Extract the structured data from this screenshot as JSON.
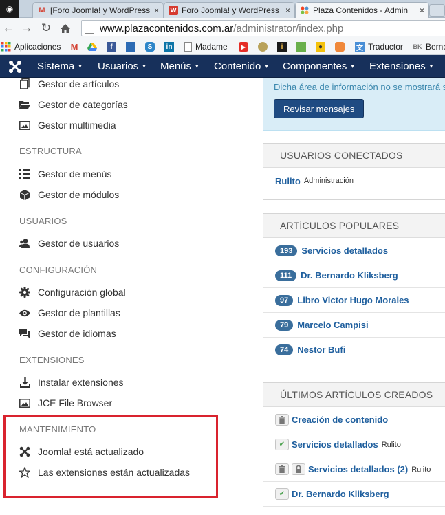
{
  "browser": {
    "tabs": [
      {
        "title": "[Foro Joomla! y WordPress"
      },
      {
        "title": "Foro Joomla! y WordPress"
      },
      {
        "title": "Plaza Contenidos - Admin"
      }
    ],
    "close_glyph": "×",
    "url_host": "www.plazacontenidos.com.ar",
    "url_path": "/administrator/index.php",
    "bookmarks": [
      {
        "label": "Aplicaciones",
        "icon": "apps-grid-icon"
      },
      {
        "label": "",
        "icon": "gmail-icon"
      },
      {
        "label": "",
        "icon": "drive-icon"
      },
      {
        "label": "",
        "icon": "facebook-icon"
      },
      {
        "label": "",
        "icon": "blue-square-icon"
      },
      {
        "label": "",
        "icon": "skype-icon"
      },
      {
        "label": "",
        "icon": "linkedin-icon"
      },
      {
        "label": "Madame",
        "icon": "page-icon"
      },
      {
        "label": "",
        "icon": "youtube-icon"
      },
      {
        "label": "",
        "icon": "eye-bookmark-icon"
      },
      {
        "label": "",
        "icon": "info-icon"
      },
      {
        "label": "",
        "icon": "puzzle-icon"
      },
      {
        "label": "",
        "icon": "map-pin-icon"
      },
      {
        "label": "",
        "icon": "orange-app-icon"
      },
      {
        "label": "Traductor",
        "icon": "translate-icon"
      },
      {
        "label": "Berne",
        "icon": "bk-icon"
      }
    ]
  },
  "joomla_nav": {
    "items": [
      "Sistema",
      "Usuarios",
      "Menús",
      "Contenido",
      "Componentes",
      "Extensiones"
    ],
    "caret": "▾"
  },
  "sidebar": {
    "content_items": [
      "Gestor de artículos",
      "Gestor de categorías",
      "Gestor multimedia"
    ],
    "structure": {
      "heading": "ESTRUCTURA",
      "items": [
        "Gestor de menús",
        "Gestor de módulos"
      ]
    },
    "users": {
      "heading": "USUARIOS",
      "items": [
        "Gestor de usuarios"
      ]
    },
    "config": {
      "heading": "CONFIGURACIÓN",
      "items": [
        "Configuración global",
        "Gestor de plantillas",
        "Gestor de idiomas"
      ]
    },
    "extensions": {
      "heading": "EXTENSIONES",
      "items": [
        "Instalar extensiones",
        "JCE File Browser"
      ]
    },
    "maintenance": {
      "heading": "MANTENIMIENTO",
      "items": [
        "Joomla! está actualizado",
        "Las extensiones están actualizadas"
      ]
    }
  },
  "info_box": {
    "text": "Dicha área de información no se mostrará s",
    "button": "Revisar mensajes"
  },
  "logged_users": {
    "title": "USUARIOS CONECTADOS",
    "user": "Rulito",
    "location": "Administración"
  },
  "popular": {
    "title": "ARTÍCULOS POPULARES",
    "items": [
      {
        "hits": "193",
        "title": "Servicios detallados"
      },
      {
        "hits": "111",
        "title": "Dr. Bernardo Kliksberg"
      },
      {
        "hits": "97",
        "title": "Libro Victor Hugo Morales"
      },
      {
        "hits": "79",
        "title": "Marcelo Campisi"
      },
      {
        "hits": "74",
        "title": "Nestor Bufi"
      }
    ]
  },
  "latest": {
    "title": "ÚLTIMOS ARTÍCULOS CREADOS",
    "items": [
      {
        "title": "Creación de contenido",
        "author": ""
      },
      {
        "title": "Servicios detallados",
        "author": "Rulito"
      },
      {
        "title": "Servicios detallados (2)",
        "author": "Rulito"
      },
      {
        "title": "Dr. Bernardo Kliksberg",
        "author": ""
      }
    ]
  },
  "colors": {
    "joomla_navbar": "#17305b",
    "link": "#1f5f9e",
    "badge": "#3a6e9c",
    "highlight_box": "#d9232e",
    "info_bg": "#d9edf7"
  }
}
